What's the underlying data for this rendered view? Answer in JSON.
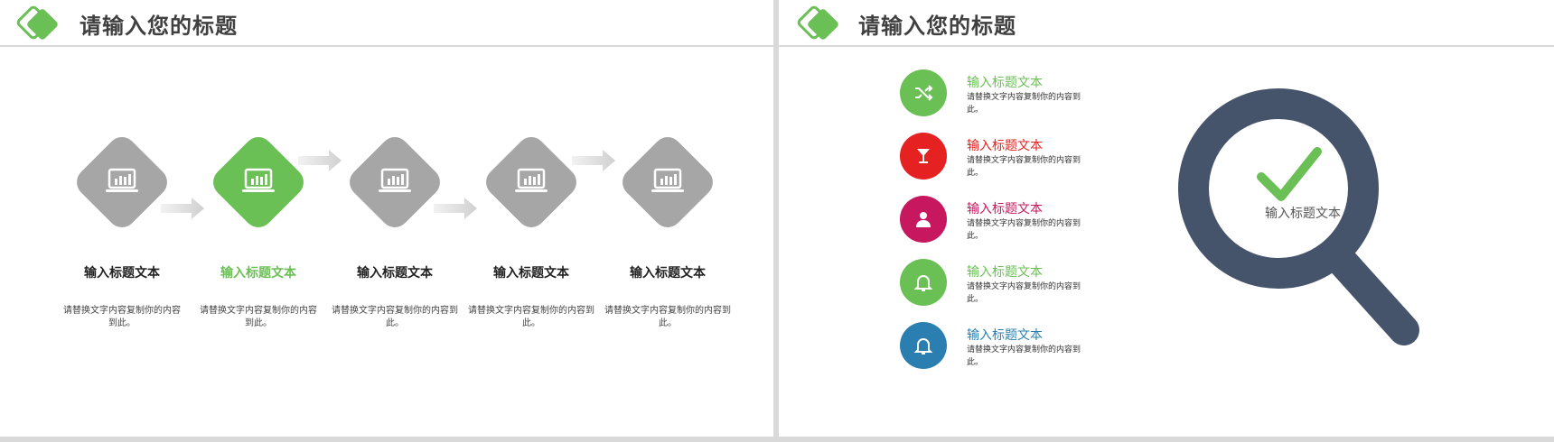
{
  "left_slide": {
    "title": "请输入您的标题",
    "items": [
      {
        "title": "输入标题文本",
        "desc": "请替换文字内容复制你的内容到此。",
        "active": false
      },
      {
        "title": "输入标题文本",
        "desc": "请替换文字内容复制你的内容到此。",
        "active": true
      },
      {
        "title": "输入标题文本",
        "desc": "请替换文字内容复制你的内容到此。",
        "active": false
      },
      {
        "title": "输入标题文本",
        "desc": "请替换文字内容复制你的内容到此。",
        "active": false
      },
      {
        "title": "输入标题文本",
        "desc": "请替换文字内容复制你的内容到此。",
        "active": false
      }
    ]
  },
  "right_slide": {
    "title": "请输入您的标题",
    "items": [
      {
        "title": "输入标题文本",
        "desc": "请替换文字内容复制你的内容到此。",
        "color": "#6abf55",
        "icon": "shuffle-icon"
      },
      {
        "title": "输入标题文本",
        "desc": "请替换文字内容复制你的内容到此。",
        "color": "#e52121",
        "icon": "cocktail-glass-icon"
      },
      {
        "title": "输入标题文本",
        "desc": "请替换文字内容复制你的内容到此。",
        "color": "#c7185f",
        "icon": "user-icon"
      },
      {
        "title": "输入标题文本",
        "desc": "请替换文字内容复制你的内容到此。",
        "color": "#6abf55",
        "icon": "bell-icon"
      },
      {
        "title": "输入标题文本",
        "desc": "请替换文字内容复制你的内容到此。",
        "color": "#2a7fb0",
        "icon": "bell-icon"
      }
    ],
    "magnifier_label": "输入标题文本"
  },
  "colors": {
    "accent": "#6abf55",
    "diamond_gray": "#a6a6a6",
    "magnifier": "#45546b"
  }
}
